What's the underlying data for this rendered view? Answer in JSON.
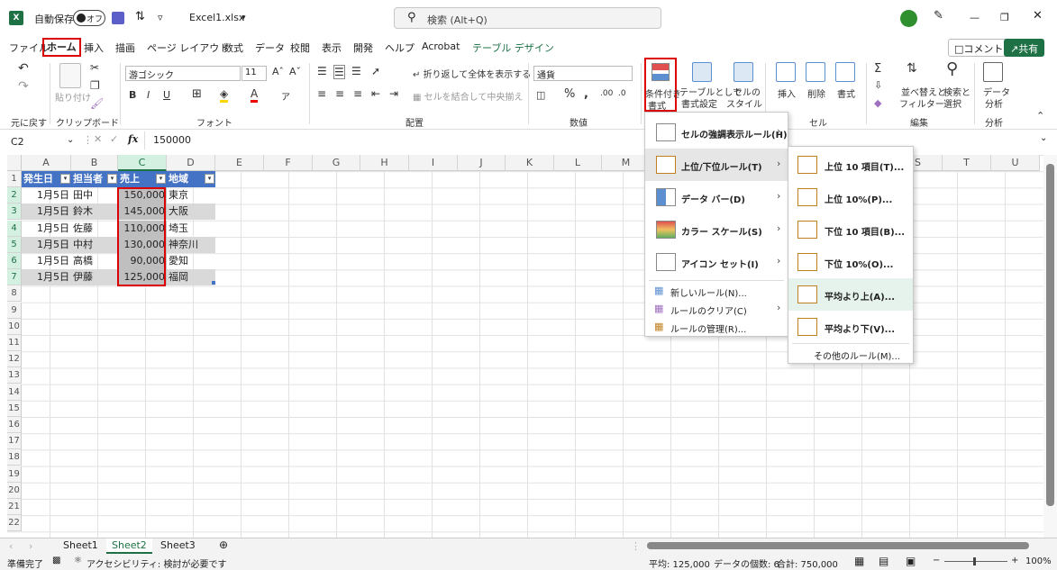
{
  "titlebar": {
    "autosave_label": "自動保存",
    "autosave_state": "オフ",
    "filename": "Excel1.xlsx",
    "search_placeholder": "検索 (Alt+Q)"
  },
  "tabs": [
    "ファイル",
    "ホーム",
    "挿入",
    "描画",
    "ページ レイアウト",
    "数式",
    "データ",
    "校閲",
    "表示",
    "開発",
    "ヘルプ",
    "Acrobat",
    "テーブル デザイン"
  ],
  "tab_buttons": {
    "comment": "コメント",
    "share": "共有"
  },
  "ribbon": {
    "undo_label": "元に戻す",
    "clipboard": {
      "label": "クリップボード",
      "paste": "貼り付け"
    },
    "font": {
      "label": "フォント",
      "name": "游ゴシック",
      "size": "11"
    },
    "alignment": {
      "label": "配置",
      "wrap": "折り返して全体を表示する",
      "merge": "セルを結合して中央揃え"
    },
    "number": {
      "label": "数値",
      "format": "通貨"
    },
    "styles": {
      "cf_line1": "条件付き",
      "cf_line2": "書式",
      "table_line1": "テーブルとして",
      "table_line2": "書式設定",
      "cellstyle_line1": "セルの",
      "cellstyle_line2": "スタイル"
    },
    "cells": {
      "label": "セル",
      "insert": "挿入",
      "delete": "削除",
      "format": "書式"
    },
    "editing": {
      "label": "編集",
      "sort_line1": "並べ替えと",
      "sort_line2": "フィルター",
      "find_line1": "検索と",
      "find_line2": "選択"
    },
    "analysis": {
      "label": "分析",
      "line1": "データ",
      "line2": "分析"
    }
  },
  "formula_bar": {
    "name_box": "C2",
    "fx": "fx",
    "value": "150000"
  },
  "grid": {
    "columns": [
      "A",
      "B",
      "C",
      "D",
      "E",
      "F",
      "G",
      "H",
      "I",
      "J",
      "K",
      "L",
      "M",
      "N",
      "O",
      "P",
      "Q",
      "R",
      "S",
      "T",
      "U"
    ],
    "rows": [
      "1",
      "2",
      "3",
      "4",
      "5",
      "6",
      "7",
      "8",
      "9",
      "10",
      "11",
      "12",
      "13",
      "14",
      "15",
      "16",
      "17",
      "18",
      "19",
      "20",
      "21",
      "22"
    ],
    "header": [
      "発生日",
      "担当者",
      "売上",
      "地域"
    ],
    "data": [
      [
        "1月5日",
        "田中",
        "150,000",
        "東京"
      ],
      [
        "1月5日",
        "鈴木",
        "145,000",
        "大阪"
      ],
      [
        "1月5日",
        "佐藤",
        "110,000",
        "埼玉"
      ],
      [
        "1月5日",
        "中村",
        "130,000",
        "神奈川"
      ],
      [
        "1月5日",
        "高橋",
        "90,000",
        "愛知"
      ],
      [
        "1月5日",
        "伊藤",
        "125,000",
        "福岡"
      ]
    ]
  },
  "cf_menu": {
    "items": [
      "セルの強調表示ルール(H)",
      "上位/下位ルール(T)",
      "データ バー(D)",
      "カラー スケール(S)",
      "アイコン セット(I)"
    ],
    "small_items": [
      "新しいルール(N)...",
      "ルールのクリア(C)",
      "ルールの管理(R)..."
    ]
  },
  "submenu": {
    "items": [
      "上位 10 項目(T)...",
      "上位 10%(P)...",
      "下位 10 項目(B)...",
      "下位 10%(O)...",
      "平均より上(A)...",
      "平均より下(V)..."
    ],
    "more": "その他のルール(M)..."
  },
  "sheets": [
    "Sheet1",
    "Sheet2",
    "Sheet3"
  ],
  "status": {
    "ready": "準備完了",
    "accessibility": "アクセシビリティ: 検討が必要です",
    "average": "平均: 125,000",
    "count": "データの個数: 6",
    "sum": "合計: 750,000",
    "zoom": "100%"
  },
  "colors": {
    "excel_green": "#1e7145",
    "table_header": "#4472c4",
    "highlight_red": "#dd0000"
  }
}
